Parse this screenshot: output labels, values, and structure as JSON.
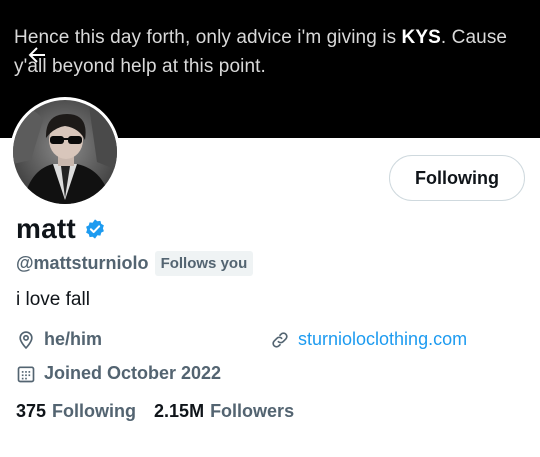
{
  "banner": {
    "text_line1_a": "Hence this day forth, only advice i'm giving is ",
    "text_line1_strong": "KYS",
    "text_line1_b": ". Cause",
    "text_line2": "y'all beyond help at this point.",
    "back_icon": "arrow-left-icon"
  },
  "profile": {
    "display_name": "matt",
    "verified_icon": "verified-badge-icon",
    "handle": "@mattsturniolo",
    "follows_you": "Follows you",
    "follow_button": "Following",
    "bio": "i love fall",
    "pronouns_icon": "location-pin-icon",
    "pronouns": "he/him",
    "website_icon": "link-icon",
    "website": "sturnioloclothing.com",
    "joined_icon": "calendar-icon",
    "joined": "Joined October 2022",
    "following_count": "375",
    "following_label": "Following",
    "followers_count": "2.15M",
    "followers_label": "Followers"
  },
  "colors": {
    "accent": "#1d9bf0",
    "text_primary": "#0f1419",
    "text_secondary": "#536471",
    "banner": "#000000"
  }
}
